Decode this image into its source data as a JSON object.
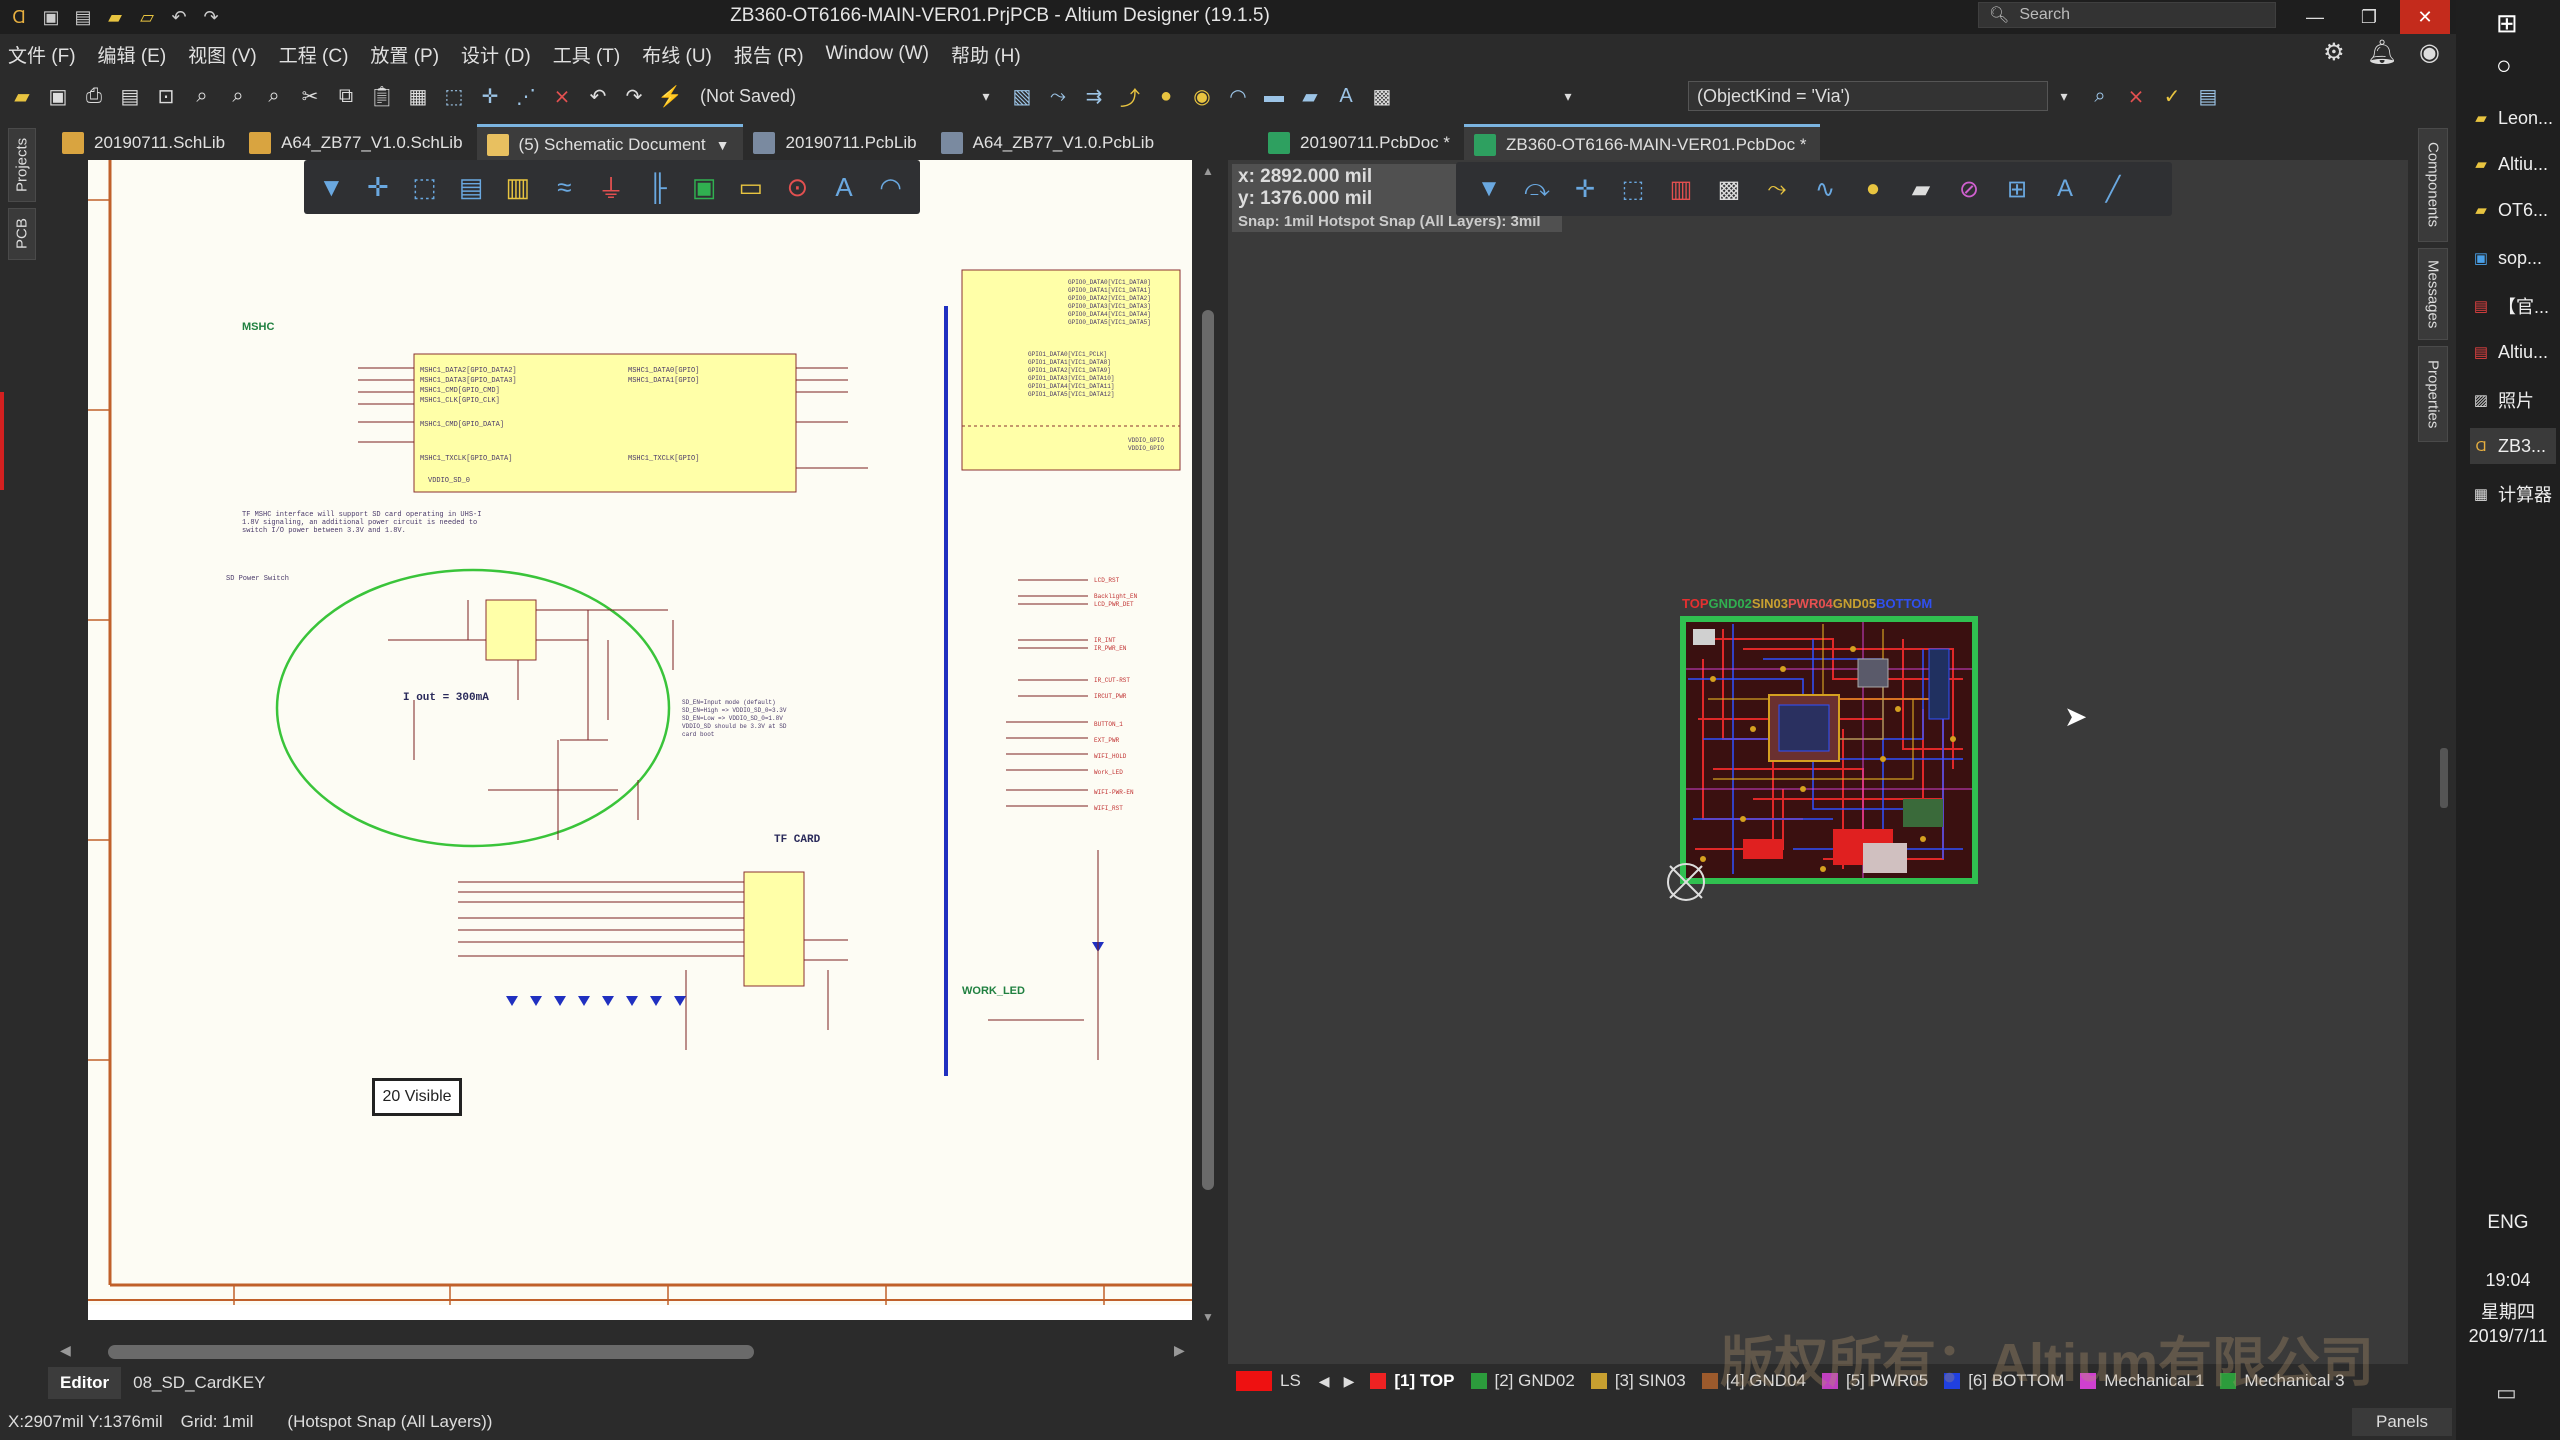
{
  "window": {
    "title": "ZB360-OT6166-MAIN-VER01.PrjPCB - Altium Designer (19.1.5)",
    "search_placeholder": "Search"
  },
  "menu": [
    "文件 (F)",
    "编辑 (E)",
    "视图 (V)",
    "工程 (C)",
    "放置 (P)",
    "设计 (D)",
    "工具 (T)",
    "布线 (U)",
    "报告 (R)",
    "Window (W)",
    "帮助 (H)"
  ],
  "toolbar": {
    "save_state": "(Not Saved)",
    "filter_query": "(ObjectKind = 'Via')"
  },
  "left_tabs": {
    "tab_groups_label": "(5) Schematic Document",
    "tabs": [
      "20190711.SchLib",
      "A64_ZB77_V1.0.SchLib",
      "20190711.PcbLib",
      "A64_ZB77_V1.0.PcbLib"
    ]
  },
  "right_tabs": [
    "20190711.PcbDoc *",
    "ZB360-OT6166-MAIN-VER01.PcbDoc *"
  ],
  "side_panels": {
    "left": [
      "Projects",
      "PCB"
    ],
    "right": [
      "Components",
      "Messages",
      "Properties"
    ]
  },
  "schematic": {
    "visible_badge": "20 Visible",
    "labels": {
      "mshc": "MSHC",
      "tf_card": "TF CARD",
      "work_led": "WORK_LED",
      "sd_power": "SD Power Switch",
      "iout": "I out = 300mA"
    },
    "editor_tabs": [
      "Editor",
      "08_SD_CardKEY"
    ]
  },
  "pcb": {
    "coord_x": "x:  2892.000 mil",
    "coord_y": "y:  1376.000 mil",
    "snap": "Snap: 1mil Hotspot Snap (All Layers): 3mil",
    "legend": [
      {
        "name": "TOP",
        "color": "#e53030"
      },
      {
        "name": "GND02",
        "color": "#30b050"
      },
      {
        "name": "SIN03",
        "color": "#c8a030"
      },
      {
        "name": "PWR04",
        "color": "#e85050"
      },
      {
        "name": "GND05",
        "color": "#c8a030"
      },
      {
        "name": "BOTTOM",
        "color": "#3050f0"
      }
    ]
  },
  "layer_tabs": [
    {
      "label": "LS",
      "color": "#ee1111"
    },
    {
      "label": "[1] TOP",
      "color": "#ee2222"
    },
    {
      "label": "[2] GND02",
      "color": "#2c9c3c"
    },
    {
      "label": "[3] SIN03",
      "color": "#c8a030"
    },
    {
      "label": "[4] GND04",
      "color": "#9c5a2c"
    },
    {
      "label": "[5] PWR05",
      "color": "#c040c0"
    },
    {
      "label": "[6] BOTTOM",
      "color": "#2040e0"
    },
    {
      "label": "Mechanical 1",
      "color": "#d040d0"
    },
    {
      "label": "Mechanical 3",
      "color": "#2c9c3c"
    }
  ],
  "status": {
    "coords": "X:2907mil Y:1376mil",
    "grid": "Grid: 1mil",
    "snap": "(Hotspot Snap (All Layers))",
    "panels": "Panels"
  },
  "watermark": "版权所有：Altium有限公司",
  "taskbar": {
    "items": [
      "Leon...",
      "Altiu...",
      "OT6...",
      "sop...",
      "【官...",
      "Altiu...",
      "照片",
      "ZB3...",
      "计算器"
    ],
    "lang": "ENG",
    "time": "19:04",
    "weekday": "星期四",
    "date": "2019/7/11"
  }
}
